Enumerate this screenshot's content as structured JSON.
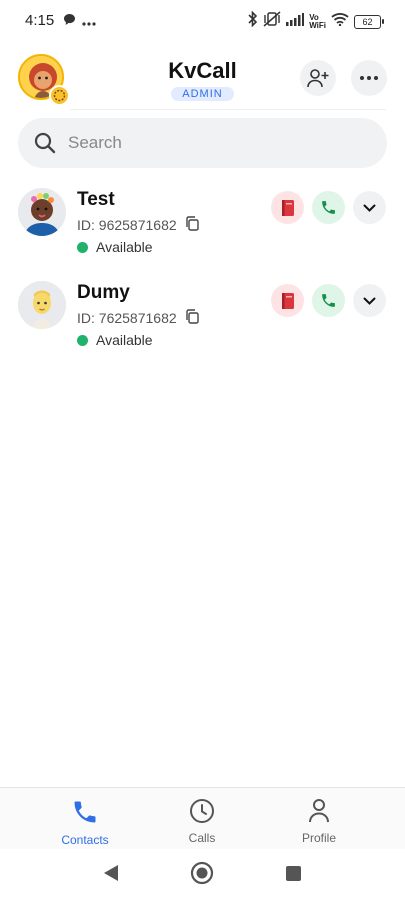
{
  "status_bar": {
    "time": "4:15",
    "vo_label": "Vo",
    "wifi_label": "WiFi",
    "battery": "62"
  },
  "header": {
    "title": "KvCall",
    "role": "ADMIN"
  },
  "search": {
    "placeholder": "Search"
  },
  "contacts": [
    {
      "name": "Test",
      "id_text": "ID: 9625871682",
      "status": "Available",
      "status_color": "#1fb26b"
    },
    {
      "name": "Dumy",
      "id_text": "ID: 7625871682",
      "status": "Available",
      "status_color": "#1fb26b"
    }
  ],
  "bottom_nav": {
    "items": [
      {
        "label": "Contacts",
        "icon": "phone-icon",
        "active": true
      },
      {
        "label": "Calls",
        "icon": "clock-icon",
        "active": false
      },
      {
        "label": "Profile",
        "icon": "person-icon",
        "active": false
      }
    ]
  },
  "colors": {
    "accent": "#2f6ee5",
    "available": "#1fb26b",
    "call_bg": "#dff5e7",
    "book_bg": "#fde3e3"
  }
}
